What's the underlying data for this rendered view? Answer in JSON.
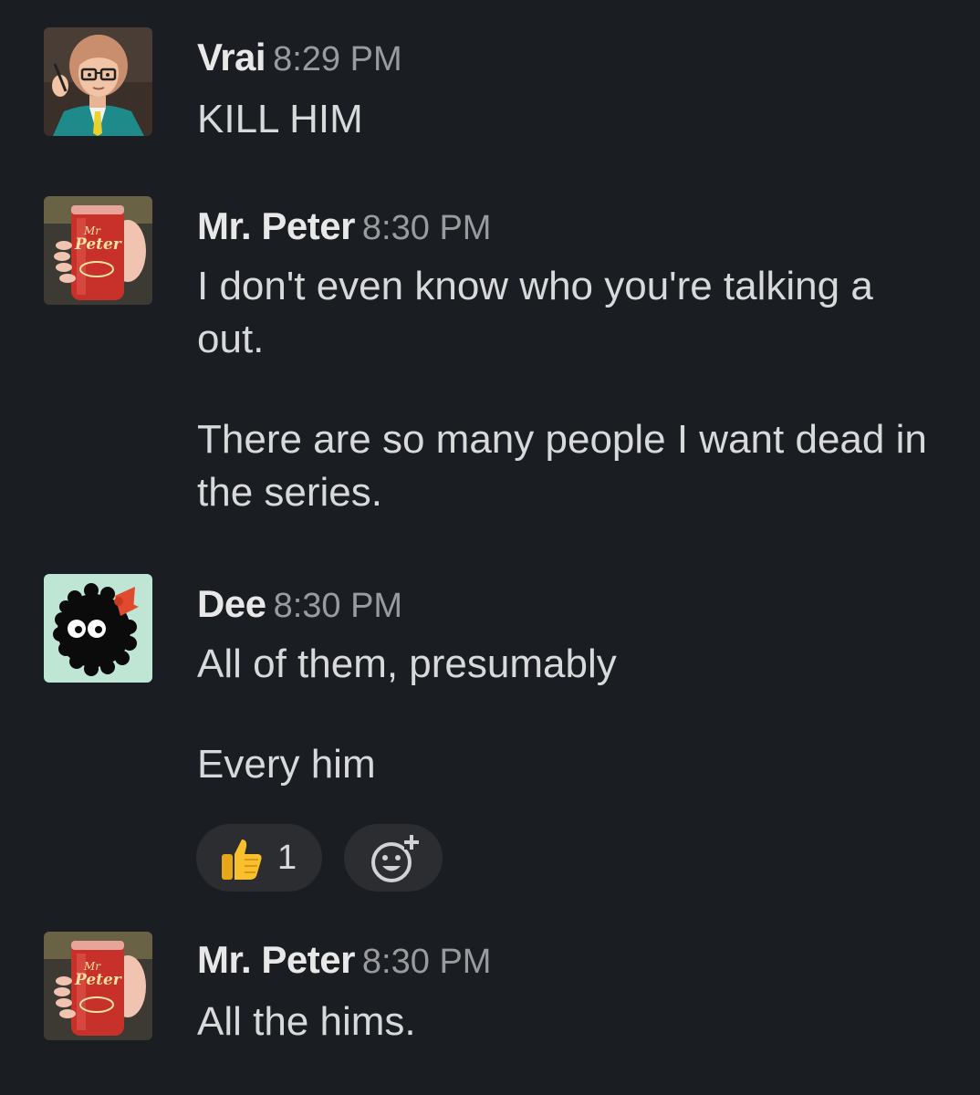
{
  "messages": [
    {
      "author": "Vrai",
      "time": "8:29 PM",
      "paragraphs": [
        "KILL HIM"
      ]
    },
    {
      "author": "Mr. Peter",
      "time": "8:30 PM",
      "paragraphs": [
        "I don't even know who you're talking a out.",
        "There are so many people I want dead in the series."
      ]
    },
    {
      "author": "Dee",
      "time": "8:30 PM",
      "paragraphs": [
        "All of them, presumably",
        "Every him"
      ],
      "reactions": [
        {
          "icon": "thumbs-up-icon",
          "count": "1"
        }
      ]
    },
    {
      "author": "Mr. Peter",
      "time": "8:30 PM",
      "paragraphs": [
        "All the hims."
      ]
    }
  ],
  "avatar_labels": {
    "mr_peter_can_text_1": "Mr",
    "mr_peter_can_text_2": "Peter"
  },
  "colors": {
    "background": "#1a1d21",
    "author": "#e8e8e8",
    "timestamp": "#9a9b9e",
    "message_text": "#d8d9da",
    "reaction_pill": "#2b2d31",
    "dee_avatar_bg": "#bfe6d4"
  },
  "icons": {
    "add_reaction": "add-reaction-icon"
  }
}
